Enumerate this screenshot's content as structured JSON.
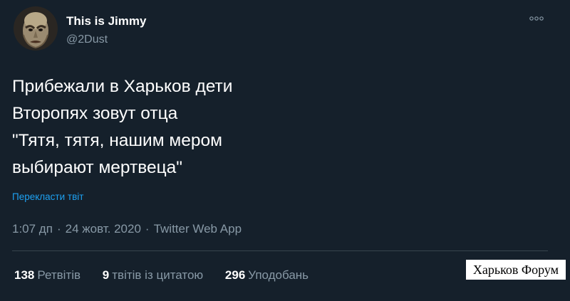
{
  "author": {
    "display_name": "This is Jimmy",
    "handle": "@2Dust",
    "avatar_icon": "avatar-face-icon"
  },
  "more_icon": "more-dots-icon",
  "tweet": {
    "lines": [
      "Прибежали в Харьков дети",
      "Второпях зовут отца",
      "\"Тятя, тятя, нашим мером",
      "выбирают мертвеца\""
    ],
    "translate_link": "Перекласти твіт"
  },
  "meta": {
    "time": "1:07 дп",
    "separator": "·",
    "date": "24 жовт. 2020",
    "source": "Twitter Web App"
  },
  "stats": {
    "retweets": {
      "count": "138",
      "label": "Ретвітів"
    },
    "quotes": {
      "count": "9",
      "label": "твітів із цитатою"
    },
    "likes": {
      "count": "296",
      "label": "Уподобань"
    }
  },
  "watermark": "Харьков Форум",
  "colors": {
    "background": "#15202b",
    "text_primary": "#ffffff",
    "text_secondary": "#8899a6",
    "link": "#1da1f2",
    "divider": "#38444d"
  }
}
